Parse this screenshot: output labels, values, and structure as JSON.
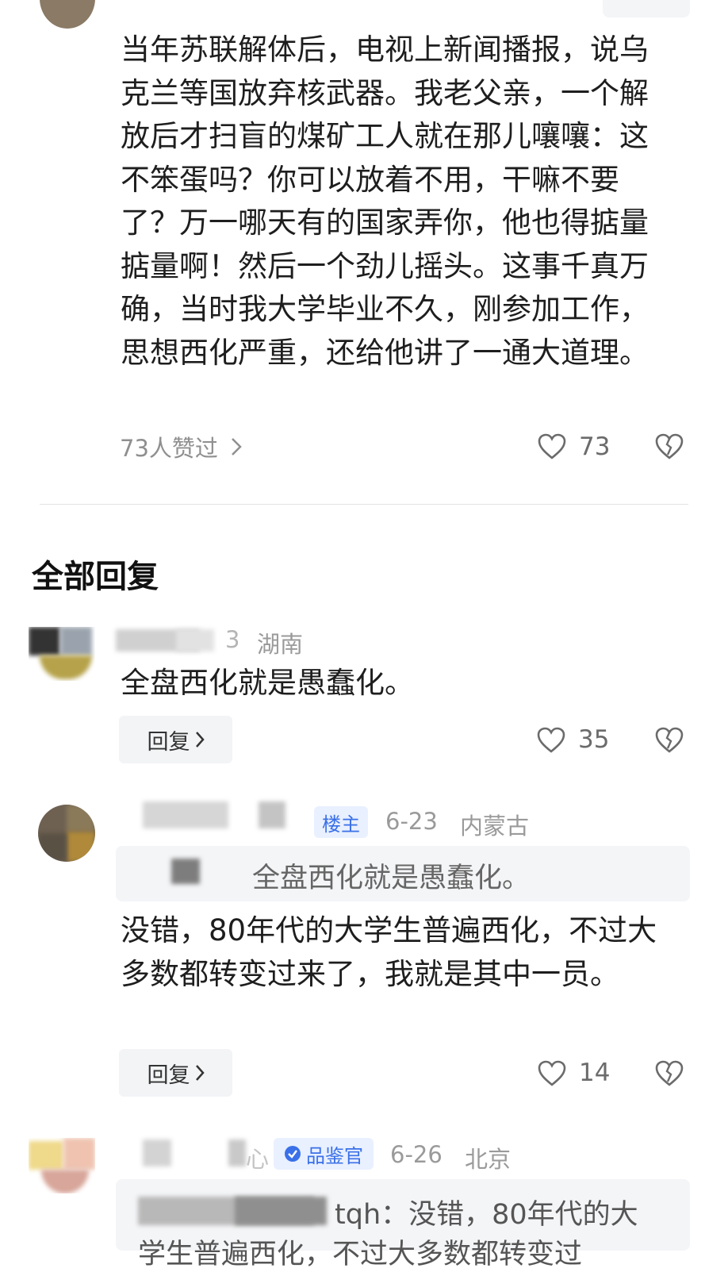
{
  "top_comment": {
    "text": "当年苏联解体后，电视上新闻播报，说乌克兰等国放弃核武器。我老父亲，一个解放后才扫盲的煤矿工人就在那儿嚷嚷：这不笨蛋吗？你可以放着不用，干嘛不要了？万一哪天有的国家弄你，他也得掂量掂量啊！然后一个劲儿摇头。这事千真万确，当时我大学毕业不久，刚参加工作，思想西化严重，还给他讲了一通大道理。",
    "likers_label": "73人赞过",
    "like_count": "73"
  },
  "section_title": "全部回复",
  "replies": [
    {
      "username_visible": "3",
      "location": "湖南",
      "text": "全盘西化就是愚蠢化。",
      "reply_label": "回复",
      "like_count": "35"
    },
    {
      "badge": "楼主",
      "date": "6-23",
      "location": "内蒙古",
      "quoted_text": "全盘西化就是愚蠢化。",
      "text": "没错，80年代的大学生普遍西化，不过大多数都转变过来了，我就是其中一员。",
      "reply_label": "回复",
      "like_count": "14"
    },
    {
      "username_visible": "心",
      "badge": "品鉴官",
      "date": "6-26",
      "location": "北京",
      "quoted_prefix": "tqh：",
      "quoted_text": "没错，80年代的大",
      "quoted_text_line2": "学生普遍西化，不过大多数都转变过"
    }
  ],
  "icons": {
    "like": "heart-outline-icon",
    "dislike": "broken-heart-icon",
    "chevron": "chevron-right-icon",
    "badge": "verified-check-icon"
  },
  "colors": {
    "text": "#1e1e1e",
    "meta": "#9a9a9a",
    "badge_blue": "#3a70e8",
    "badge_bg": "#e9f0ff",
    "quote_bg": "#f4f5f7",
    "button_bg": "#f3f4f6"
  }
}
